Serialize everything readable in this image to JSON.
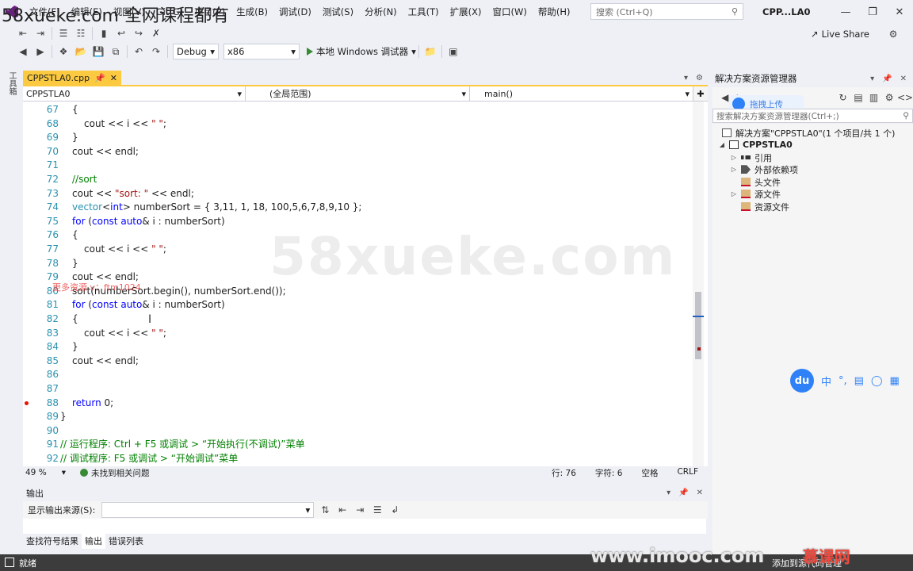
{
  "overlay": {
    "top_watermark": "58xueke.com 全网课程都有",
    "center_watermark": "58xueke.com",
    "ad_text": "更多资源 v：ftm1024",
    "imooc": "www.imooc.com",
    "imooc_brand": "慕课网"
  },
  "menu": [
    "文件(F)",
    "编辑(E)",
    "视图(V)",
    "Git(G)",
    "项目(P)",
    "生成(B)",
    "调试(D)",
    "测试(S)",
    "分析(N)",
    "工具(T)",
    "扩展(X)",
    "窗口(W)",
    "帮助(H)"
  ],
  "search": {
    "placeholder": "搜索 (Ctrl+Q)"
  },
  "app_title": "CPP...LA0",
  "toolbar": {
    "config": "Debug",
    "platform": "x86",
    "run_label": "本地 Windows 调试器",
    "liveshare": "Live Share"
  },
  "left_strip": {
    "tab": "工具箱"
  },
  "editor": {
    "tab_name": "CPPSTLA0.cpp",
    "nav_project": "CPPSTLA0",
    "nav_scope": "(全局范围)",
    "nav_member": "main()",
    "zoom": "49 %",
    "issues": "未找到相关问题",
    "line": "行: 76",
    "col": "字符: 6",
    "space": "空格",
    "eol": "CRLF"
  },
  "code_lines": [
    {
      "n": "67",
      "indent": 1,
      "html": "{"
    },
    {
      "n": "68",
      "indent": 2,
      "html": "cout &lt;&lt; i &lt;&lt; <span class='str'>\" \"</span>;"
    },
    {
      "n": "69",
      "indent": 1,
      "html": "}"
    },
    {
      "n": "70",
      "indent": 1,
      "html": "cout &lt;&lt; endl;"
    },
    {
      "n": "71",
      "indent": 0,
      "html": ""
    },
    {
      "n": "72",
      "indent": 1,
      "html": "<span class='cm'>//sort</span>"
    },
    {
      "n": "73",
      "indent": 1,
      "html": "cout &lt;&lt; <span class='str'>\"sort: \"</span> &lt;&lt; endl;"
    },
    {
      "n": "74",
      "indent": 1,
      "html": "<span class='ty'>vector</span>&lt;<span class='kw'>int</span>&gt; numberSort = { 3,11, 1, 18, 100,5,6,7,8,9,10 };"
    },
    {
      "n": "75",
      "indent": 1,
      "html": "<span class='kw'>for</span> (<span class='kw'>const</span> <span class='kw'>auto</span>&amp; i : numberSort)"
    },
    {
      "n": "76",
      "indent": 1,
      "html": "{"
    },
    {
      "n": "77",
      "indent": 2,
      "html": "cout &lt;&lt; i &lt;&lt; <span class='str'>\" \"</span>;"
    },
    {
      "n": "78",
      "indent": 1,
      "html": "}"
    },
    {
      "n": "79",
      "indent": 1,
      "html": "cout &lt;&lt; endl;"
    },
    {
      "n": "80",
      "indent": 1,
      "html": "sort(numberSort.begin(), numberSort.end());"
    },
    {
      "n": "81",
      "indent": 1,
      "html": "<span class='kw'>for</span> (<span class='kw'>const</span> <span class='kw'>auto</span>&amp; i : numberSort)"
    },
    {
      "n": "82",
      "indent": 1,
      "html": "{"
    },
    {
      "n": "83",
      "indent": 2,
      "html": "cout &lt;&lt; i &lt;&lt; <span class='str'>\" \"</span>;"
    },
    {
      "n": "84",
      "indent": 1,
      "html": "}"
    },
    {
      "n": "85",
      "indent": 1,
      "html": "cout &lt;&lt; endl;"
    },
    {
      "n": "86",
      "indent": 0,
      "html": ""
    },
    {
      "n": "87",
      "indent": 0,
      "html": ""
    },
    {
      "n": "88",
      "indent": 1,
      "html": "<span class='kw'>return</span> 0;",
      "breakpoint": true
    },
    {
      "n": "89",
      "indent": 0,
      "html": "}"
    },
    {
      "n": "90",
      "indent": 0,
      "html": ""
    },
    {
      "n": "91",
      "indent": 0,
      "html": "<span class='cm'>// 运行程序: Ctrl + F5 或调试 &gt; “开始执行(不调试)”菜单</span>"
    },
    {
      "n": "92",
      "indent": 0,
      "html": "<span class='cm'>// 调试程序: F5 或调试 &gt; “开始调试”菜单</span>"
    }
  ],
  "output": {
    "title": "输出",
    "source_label": "显示输出来源(S):"
  },
  "bottom_tabs": [
    "查找符号结果",
    "输出",
    "错误列表"
  ],
  "solution_explorer": {
    "title": "解决方案资源管理器",
    "baidu_btn": "拖拽上传",
    "search_placeholder": "搜索解决方案资源管理器(Ctrl+;)",
    "solution": "解决方案\"CPPSTLA0\"(1 个项目/共 1 个)",
    "project": "CPPSTLA0",
    "items": [
      "引用",
      "外部依赖项",
      "头文件",
      "源文件",
      "资源文件"
    ]
  },
  "float_bar": {
    "du": "du",
    "zh": "中"
  },
  "status": {
    "ready": "就绪",
    "right": "添加到源代码管理"
  }
}
